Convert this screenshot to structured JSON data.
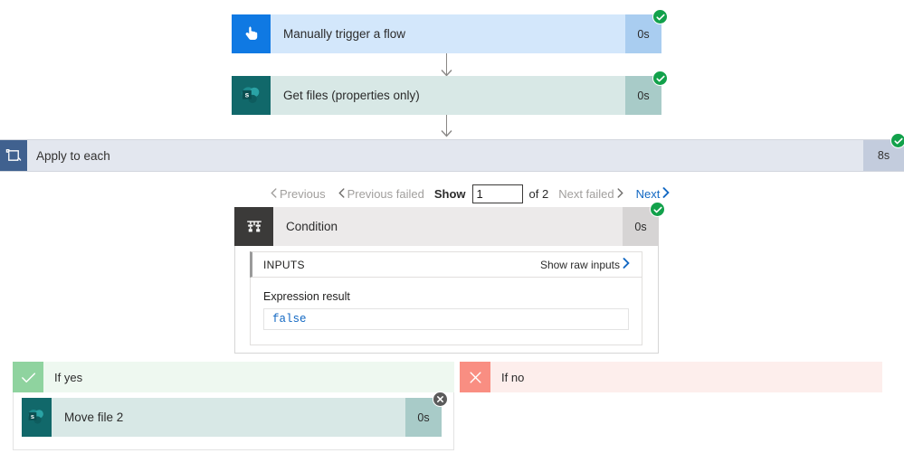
{
  "flow": {
    "trigger": {
      "title": "Manually trigger a flow",
      "duration": "0s",
      "icon": "hand-tap-icon",
      "status": "succeeded",
      "accent": "#0f79e3"
    },
    "get_files": {
      "title": "Get files (properties only)",
      "duration": "0s",
      "icon": "sharepoint-icon",
      "status": "succeeded",
      "accent": "#11686a"
    },
    "apply_to_each": {
      "title": "Apply to each",
      "duration": "8s",
      "icon": "loop-icon",
      "status": "succeeded"
    },
    "condition": {
      "title": "Condition",
      "duration": "0s",
      "icon": "condition-branch-icon",
      "status": "succeeded"
    },
    "move_file": {
      "title": "Move file 2",
      "duration": "0s",
      "icon": "sharepoint-icon",
      "status": "skipped",
      "accent": "#11686a"
    }
  },
  "pager": {
    "previous": "Previous",
    "previous_failed": "Previous failed",
    "show_label": "Show",
    "show_value": "1",
    "of_label": "of 2",
    "next_failed": "Next failed",
    "next": "Next"
  },
  "inputs_panel": {
    "header": "INPUTS",
    "raw_link": "Show raw inputs",
    "expression_label": "Expression result",
    "expression_value": "false"
  },
  "branches": {
    "yes": {
      "label": "If yes",
      "icon": "check-icon"
    },
    "no": {
      "label": "If no",
      "icon": "cross-icon"
    }
  },
  "colors": {
    "success_green": "#12a14b",
    "skipped_grey": "#5b5b5b",
    "link_blue": "#1268c3",
    "yes_green": "#8fd39f",
    "no_red": "#f98e82"
  }
}
